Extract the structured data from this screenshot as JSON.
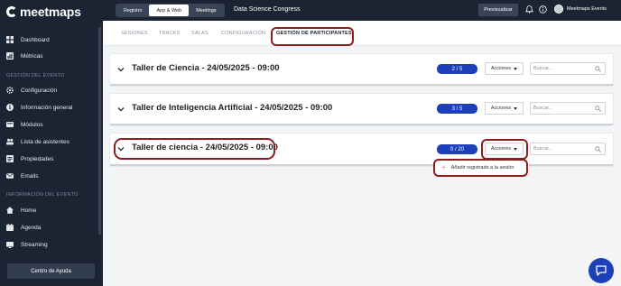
{
  "brand": {
    "logo_text": "meetmaps"
  },
  "sidebar": {
    "items_top": [
      {
        "label": "Dashboard",
        "icon": "grid-icon"
      },
      {
        "label": "Métricas",
        "icon": "chart-icon"
      }
    ],
    "section_event_label": "GESTIÓN DEL EVENTO",
    "items_event": [
      {
        "label": "Configuración",
        "icon": "gear-icon"
      },
      {
        "label": "Información general",
        "icon": "info-icon"
      },
      {
        "label": "Módulos",
        "icon": "modules-icon"
      },
      {
        "label": "Lista de asistentes",
        "icon": "users-icon"
      },
      {
        "label": "Propiedades",
        "icon": "list-icon"
      },
      {
        "label": "Emails",
        "icon": "mail-icon"
      }
    ],
    "section_info_label": "INFORMACIÓN DEL EVENTO",
    "items_info": [
      {
        "label": "Home",
        "icon": "home-icon"
      },
      {
        "label": "Agenda",
        "icon": "calendar-icon"
      },
      {
        "label": "Streaming",
        "icon": "streaming-icon"
      }
    ],
    "help_label": "Centro de Ayuda"
  },
  "topbar": {
    "segments": [
      "Registro",
      "App & Web",
      "Meetings"
    ],
    "active_segment": "App & Web",
    "event_title": "Data Science Congress",
    "preview_label": "Previsualizar",
    "user_name": "Meetmaps Events"
  },
  "subtabs": [
    "SESIONES",
    "TRACKS",
    "SALAS",
    "CONFIGURACIÓN",
    "GESTIÓN DE PARTICIPANTES"
  ],
  "active_subtab": "GESTIÓN DE PARTICIPANTES",
  "sessions": [
    {
      "title": "Taller de Ciencia - 24/05/2025 - 09:00",
      "count": "2 / 5",
      "actions_label": "Acciones",
      "search_placeholder": "Buscar..."
    },
    {
      "title": "Taller de Inteligencia Artificial - 24/05/2025 - 09:00",
      "count": "3 / 5",
      "actions_label": "Acciones",
      "search_placeholder": "Buscar..."
    },
    {
      "title": "Taller de ciencia - 24/05/2025 - 09:00",
      "count": "0 / 20",
      "actions_label": "Acciones",
      "search_placeholder": "Buscar..."
    }
  ],
  "dropdown": {
    "item_label": "Añadir registrado a la sesión",
    "item_icon": "plus-icon"
  },
  "colors": {
    "sidebar_bg": "#1b2433",
    "accent": "#1d3fb8",
    "annotation": "#8b1e1e"
  }
}
